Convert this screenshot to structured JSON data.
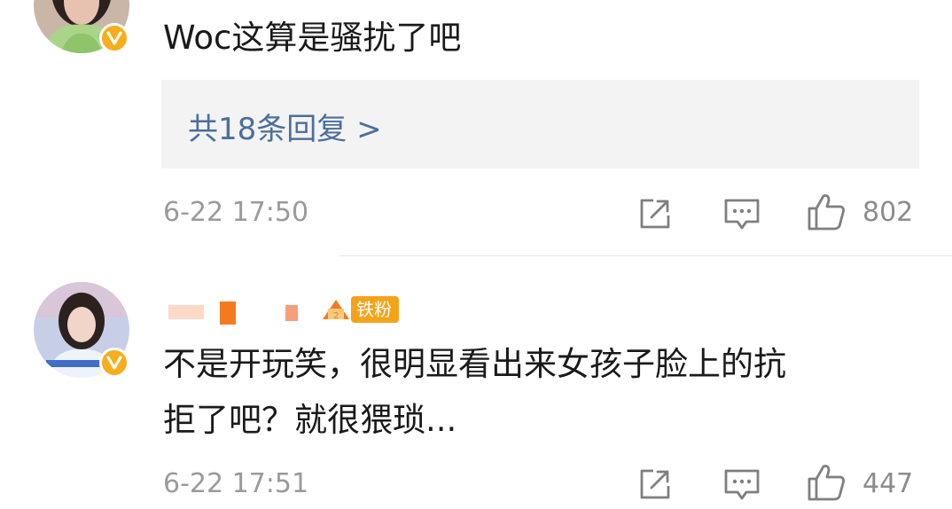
{
  "comments": [
    {
      "text": "Woc这算是骚扰了吧",
      "replies_label": "共18条回复 >",
      "time": "6-22 17:50",
      "likes": "802"
    },
    {
      "fan_badge": "铁粉",
      "text_line1": "不是开玩笑，很明显看出来女孩子脸上的抗",
      "text_line2": "拒了吧？就很猥琐...",
      "time": "6-22 17:51",
      "likes": "447"
    }
  ],
  "icons": [
    "verified-badge-icon",
    "share-icon",
    "comment-icon",
    "thumbs-up-icon"
  ],
  "colors": {
    "link": "#4a6e9e",
    "verified": "#f7ad1c",
    "fan_badge": "#f4a319",
    "reply_box": "#f3f3f3",
    "meta_text": "#9a9a9a"
  }
}
